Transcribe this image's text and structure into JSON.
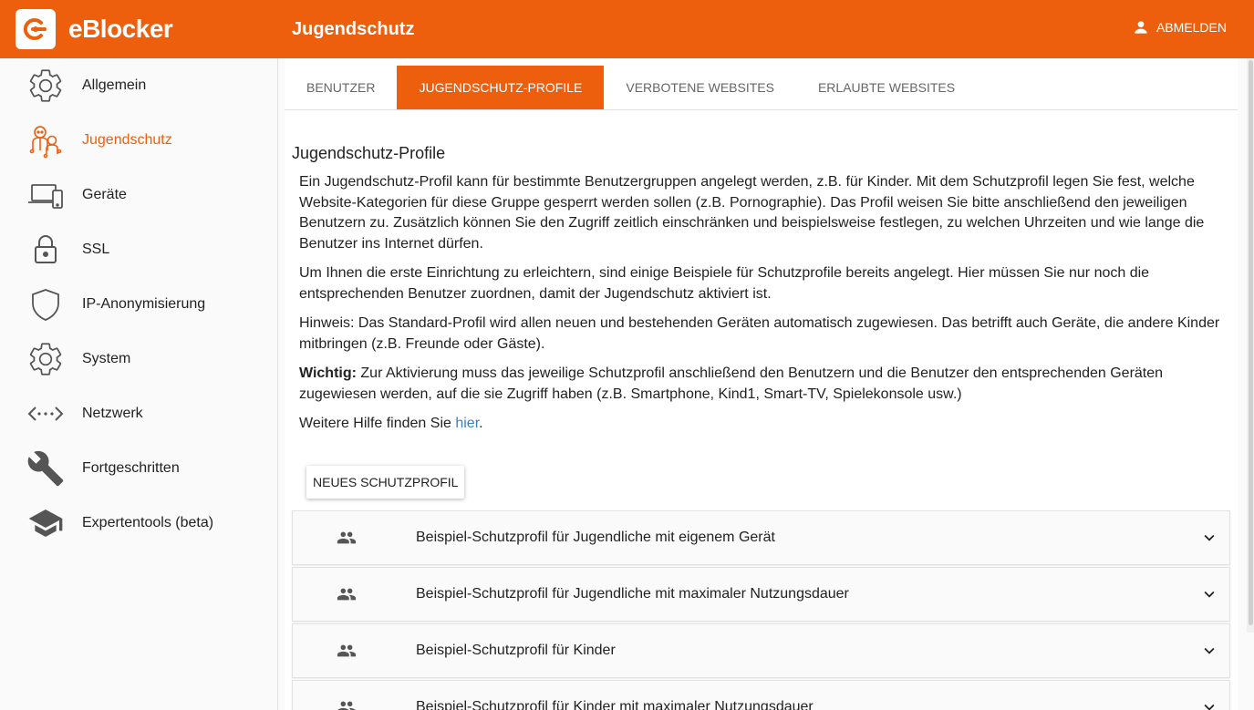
{
  "app": {
    "name": "eBlocker"
  },
  "header": {
    "title": "Jugendschutz",
    "logout_label": "ABMELDEN"
  },
  "sidebar": {
    "items": [
      {
        "label": "Allgemein",
        "icon": "gear-icon"
      },
      {
        "label": "Jugendschutz",
        "icon": "family-icon",
        "active": true
      },
      {
        "label": "Geräte",
        "icon": "devices-icon"
      },
      {
        "label": "SSL",
        "icon": "lock-icon"
      },
      {
        "label": "IP-Anonymisierung",
        "icon": "shield-icon"
      },
      {
        "label": "System",
        "icon": "gear-icon"
      },
      {
        "label": "Netzwerk",
        "icon": "network-icon"
      },
      {
        "label": "Fortgeschritten",
        "icon": "wrench-icon"
      },
      {
        "label": "Expertentools (beta)",
        "icon": "graduation-cap-icon"
      }
    ]
  },
  "tabs": [
    {
      "label": "BENUTZER"
    },
    {
      "label": "JUGENDSCHUTZ-PROFILE",
      "active": true
    },
    {
      "label": "VERBOTENE WEBSITES"
    },
    {
      "label": "ERLAUBTE WEBSITES"
    }
  ],
  "main": {
    "title": "Jugendschutz-Profile",
    "paragraphs": [
      "Ein Jugendschutz-Profil kann für bestimmte Benutzergruppen angelegt werden, z.B. für Kinder. Mit dem Schutzprofil legen Sie fest, welche Website-Kategorien für diese Gruppe gesperrt werden sollen (z.B. Pornographie). Das Profil weisen Sie bitte anschließend den jeweiligen Benutzern zu. Zusätzlich können Sie den Zugriff zeitlich einschränken und beispielsweise festlegen, zu welchen Uhrzeiten und wie lange die Benutzer ins Internet dürfen.",
      "Um Ihnen die erste Einrichtung zu erleichtern, sind einige Beispiele für Schutzprofile bereits angelegt. Hier müssen Sie nur noch die entsprechenden Benutzer zuordnen, damit der Jugendschutz aktiviert ist.",
      "Hinweis: Das Standard-Profil wird allen neuen und bestehenden Geräten automatisch zugewiesen. Das betrifft auch Geräte, die andere Kinder mitbringen (z.B. Freunde oder Gäste)."
    ],
    "important_label": "Wichtig:",
    "important_text": " Zur Aktivierung muss das jeweilige Schutzprofil anschließend den Benutzern und die Benutzer den entsprechenden Geräten zugewiesen werden, auf die sie Zugriff haben (z.B. Smartphone, Kind1, Smart-TV, Spielekonsole usw.)",
    "help_prefix": "Weitere Hilfe finden Sie ",
    "help_link": "hier",
    "help_suffix": ".",
    "new_button": "NEUES SCHUTZPROFIL"
  },
  "profiles": [
    {
      "name": "Beispiel-Schutzprofil für Jugendliche mit eigenem Gerät"
    },
    {
      "name": "Beispiel-Schutzprofil für Jugendliche mit maximaler Nutzungsdauer"
    },
    {
      "name": "Beispiel-Schutzprofil für Kinder"
    },
    {
      "name": "Beispiel-Schutzprofil für Kinder mit maximaler Nutzungsdauer"
    }
  ],
  "colors": {
    "accent": "#ed5f0c",
    "link": "#3a7fc2",
    "icon": "#555555"
  }
}
